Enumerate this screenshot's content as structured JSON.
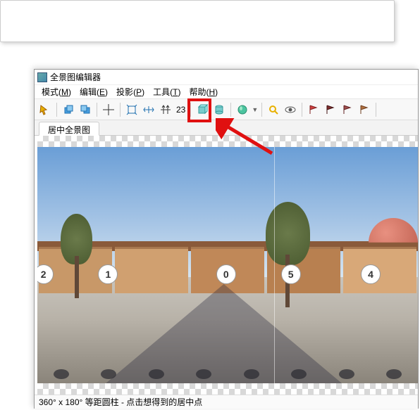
{
  "window": {
    "title": "全景图编辑器"
  },
  "menubar": {
    "items": [
      {
        "label": "模式",
        "accel": "M"
      },
      {
        "label": "编辑",
        "accel": "E"
      },
      {
        "label": "投影",
        "accel": "P"
      },
      {
        "label": "工具",
        "accel": "T"
      },
      {
        "label": "帮助",
        "accel": "H"
      }
    ]
  },
  "toolbar": {
    "num_field": "23"
  },
  "tabs": {
    "items": [
      {
        "label": "居中全景图"
      }
    ]
  },
  "panorama": {
    "hotspots": [
      {
        "label": "2",
        "left_pct": -1
      },
      {
        "label": "1",
        "left_pct": 16
      },
      {
        "label": "0",
        "left_pct": 47
      },
      {
        "label": "5",
        "left_pct": 64
      },
      {
        "label": "4",
        "left_pct": 85
      }
    ]
  },
  "statusbar": {
    "text": "360° x 180° 等距圆柱 - 点击想得到的居中点"
  }
}
